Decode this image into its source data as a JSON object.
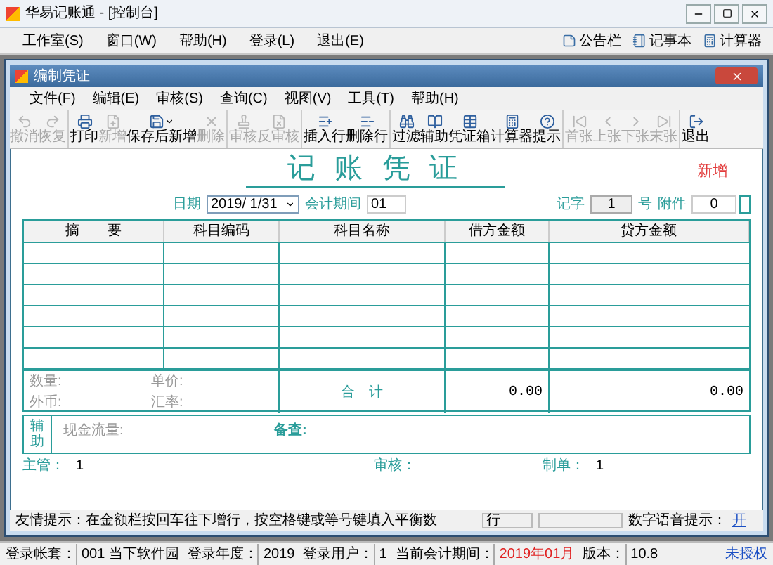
{
  "window": {
    "title": "华易记账通 - [控制台]"
  },
  "menu": [
    "工作室(S)",
    "窗口(W)",
    "帮助(H)",
    "登录(L)",
    "退出(E)"
  ],
  "quick_tools": [
    "公告栏",
    "记事本",
    "计算器"
  ],
  "voucher_window": {
    "title": "编制凭证",
    "menu": [
      "文件(F)",
      "编辑(E)",
      "审核(S)",
      "查询(C)",
      "视图(V)",
      "工具(T)",
      "帮助(H)"
    ],
    "toolbar": [
      [
        {
          "label": "撤消",
          "disabled": true
        },
        {
          "label": "恢复",
          "disabled": true
        }
      ],
      [
        {
          "label": "打印",
          "disabled": false
        },
        {
          "label": "新增",
          "disabled": true
        },
        {
          "label": "保存后新增",
          "disabled": false,
          "dropdown": true
        },
        {
          "label": "删除",
          "disabled": true
        }
      ],
      [
        {
          "label": "审核",
          "disabled": true
        },
        {
          "label": "反审核",
          "disabled": true
        }
      ],
      [
        {
          "label": "插入行",
          "disabled": false
        },
        {
          "label": "删除行",
          "disabled": false
        }
      ],
      [
        {
          "label": "过滤",
          "disabled": false
        },
        {
          "label": "辅助",
          "disabled": false
        },
        {
          "label": "凭证箱",
          "disabled": false
        },
        {
          "label": "计算器",
          "disabled": false
        },
        {
          "label": "提示",
          "disabled": false
        }
      ],
      [
        {
          "label": "首张",
          "disabled": true
        },
        {
          "label": "上张",
          "disabled": true
        },
        {
          "label": "下张",
          "disabled": true
        },
        {
          "label": "末张",
          "disabled": true
        }
      ],
      [
        {
          "label": "退出",
          "disabled": false
        }
      ]
    ],
    "voucher": {
      "title": "记 账 凭 证",
      "mode": "新增",
      "date_label": "日期",
      "date": "2019/ 1/31",
      "period_label": "会计期间",
      "period": "01",
      "word_label": "记字",
      "number": "1",
      "number_suffix": "号",
      "attachments_label": "附件",
      "attachments": "0",
      "columns": [
        "摘　　要",
        "科目编码",
        "科目名称",
        "借方金额",
        "贷方金额"
      ],
      "row_count_rows": [
        {},
        {},
        {},
        {},
        {},
        {}
      ],
      "quantity_label": "数量:",
      "unit_price_label": "单价:",
      "currency_label": "外币:",
      "rate_label": "汇率:",
      "total_label": "合　计",
      "debit_total": "0.00",
      "credit_total": "0.00",
      "aux_label": "辅助",
      "cash_flow_label": "现金流量:",
      "memo_label": "备查:",
      "signatures": [
        {
          "label": "主管：",
          "value": "1"
        },
        {
          "label": "审核："
        },
        {
          "label": "制单：",
          "value": "1"
        }
      ]
    },
    "hint": "友情提示：在金额栏按回车往下增行，按空格键或等号键填入平衡数",
    "row_field": "行",
    "voice_label": "数字语音提示：",
    "voice_value": "开"
  },
  "status_bar": {
    "fields": [
      {
        "label": "登录帐套：",
        "value": "001 当下软件园",
        "warn": false
      },
      {
        "label": "登录年度：",
        "value": "2019",
        "warn": false
      },
      {
        "label": "登录用户：",
        "value": "1",
        "warn": false
      },
      {
        "label": "当前会计期间：",
        "value": "2019年01月",
        "warn": true
      },
      {
        "label": "版本：",
        "value": "10.8",
        "warn": false
      }
    ],
    "license": "未授权"
  }
}
